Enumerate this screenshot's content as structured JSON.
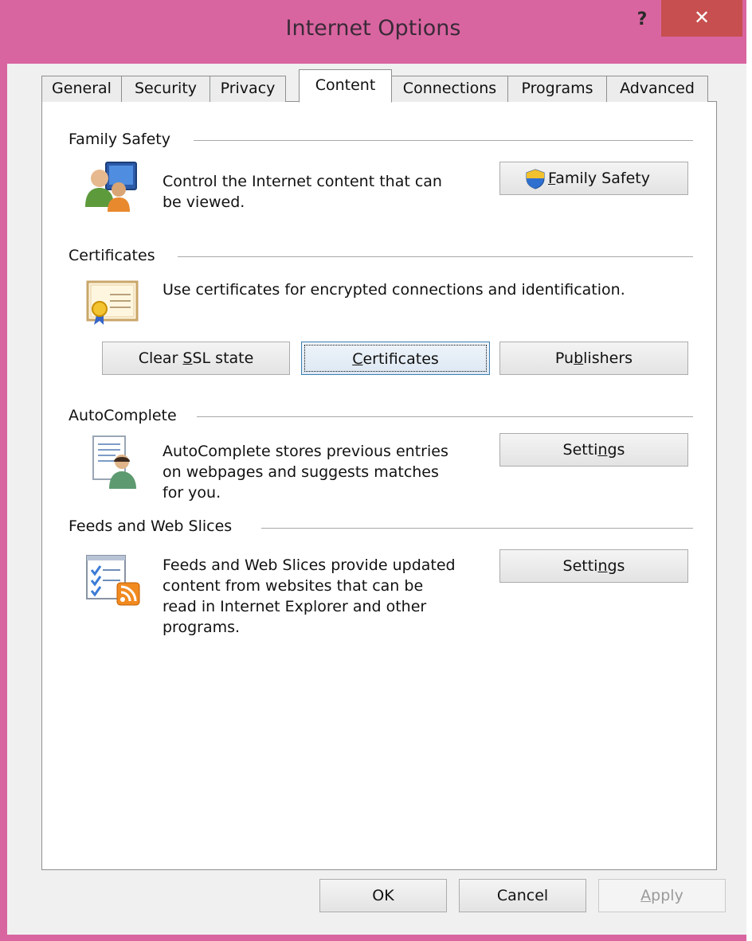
{
  "window": {
    "title": "Internet Options",
    "help": "?",
    "close": "✕"
  },
  "tabs": [
    {
      "label": "General"
    },
    {
      "label": "Security"
    },
    {
      "label": "Privacy"
    },
    {
      "label": "Content"
    },
    {
      "label": "Connections"
    },
    {
      "label": "Programs"
    },
    {
      "label": "Advanced"
    }
  ],
  "active_tab": "Content",
  "family_safety": {
    "heading": "Family Safety",
    "line1": "Control the Internet content that can",
    "line2": "be viewed.",
    "button_prefix": "",
    "button_mnemonic": "F",
    "button_rest": "amily Safety"
  },
  "certificates": {
    "heading": "Certificates",
    "text": "Use certificates for encrypted connections and identification.",
    "clear_ssl": {
      "pre": "Clear ",
      "mn": "S",
      "post": "SL state"
    },
    "certificates_btn": {
      "pre": "",
      "mn": "C",
      "post": "ertificates"
    },
    "publishers_btn": {
      "pre": "Pu",
      "mn": "b",
      "post": "lishers"
    }
  },
  "autocomplete": {
    "heading": "AutoComplete",
    "line1": "AutoComplete stores previous entries",
    "line2": "on webpages and suggests matches",
    "line3": "for you.",
    "settings": {
      "pre": "Setti",
      "mn": "n",
      "post": "gs"
    }
  },
  "feeds": {
    "heading": "Feeds and Web Slices",
    "line1": "Feeds and Web Slices provide updated",
    "line2": "content from websites that can be",
    "line3": "read in Internet Explorer and other",
    "line4": "programs.",
    "settings": {
      "pre": "Setti",
      "mn": "n",
      "post": "gs"
    }
  },
  "footer": {
    "ok": "OK",
    "cancel": "Cancel",
    "apply": {
      "pre": "",
      "mn": "A",
      "post": "pply"
    }
  },
  "colors": {
    "titlebar": "#d965a0",
    "close": "#c74f4f",
    "focus": "#3c7fb1"
  },
  "icons": [
    "family-safety-icon",
    "certificate-icon",
    "autocomplete-icon",
    "feeds-icon",
    "uac-shield-icon"
  ]
}
